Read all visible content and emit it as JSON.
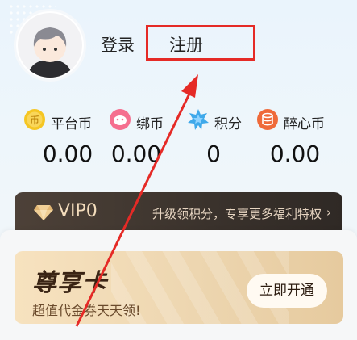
{
  "header": {
    "login_label": "登录",
    "register_label": "注册",
    "highlight_color": "#e52a26"
  },
  "currencies": [
    {
      "name": "平台币",
      "value": "0.00",
      "icon": "coin-icon",
      "color": "#f2c12e"
    },
    {
      "name": "绑币",
      "value": "0.00",
      "icon": "pig-coin-icon",
      "color": "#f06a8a"
    },
    {
      "name": "积分",
      "value": "0",
      "icon": "points-star-icon",
      "color": "#38a6e8"
    },
    {
      "name": "醉心币",
      "value": "0.00",
      "icon": "database-coin-icon",
      "color": "#ef6a3a"
    }
  ],
  "vip": {
    "label": "VIP0",
    "link_text": "升级领积分，专享更多福利特权",
    "chevron": "›"
  },
  "card": {
    "title": "尊享卡",
    "subtitle": "超值代金券天天领!",
    "button_label": "立即开通"
  }
}
